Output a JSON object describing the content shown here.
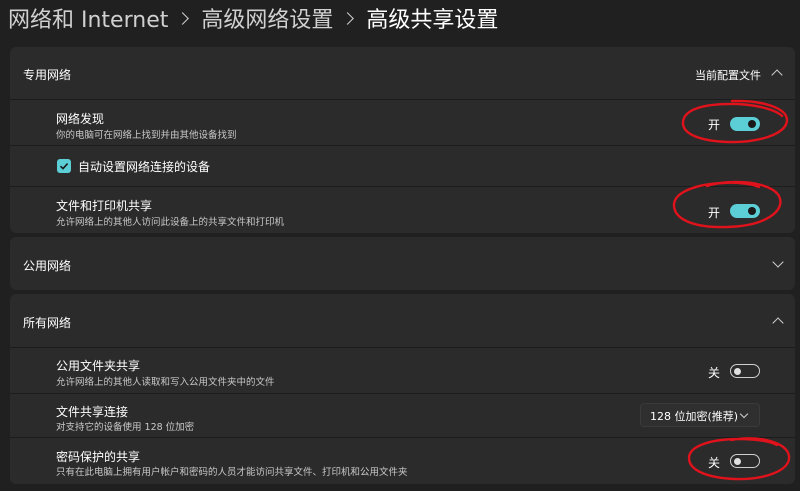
{
  "breadcrumb": {
    "items": [
      "网络和 Internet",
      "高级网络设置",
      "高级共享设置"
    ]
  },
  "private_network": {
    "title": "专用网络",
    "profile_label": "当前配置文件",
    "network_discovery": {
      "title": "网络发现",
      "description": "你的电脑可在网络上找到并由其他设备找到",
      "state_label": "开",
      "on": true
    },
    "auto_setup": {
      "label": "自动设置网络连接的设备",
      "checked": true
    },
    "file_printer_sharing": {
      "title": "文件和打印机共享",
      "description": "允许网络上的其他人访问此设备上的共享文件和打印机",
      "state_label": "开",
      "on": true
    }
  },
  "public_network": {
    "title": "公用网络"
  },
  "all_networks": {
    "title": "所有网络",
    "public_folder_sharing": {
      "title": "公用文件夹共享",
      "description": "允许网络上的其他人读取和写入公用文件夹中的文件",
      "state_label": "关",
      "on": false
    },
    "file_sharing_connections": {
      "title": "文件共享连接",
      "description": "对支持它的设备使用 128 位加密",
      "selected": "128 位加密(推荐)"
    },
    "password_protected_sharing": {
      "title": "密码保护的共享",
      "description": "只有在此电脑上拥有用户帐户和密码的人员才能访问共享文件、打印机和公用文件夹",
      "state_label": "关",
      "on": false
    }
  },
  "colors": {
    "accent": "#5ccfd6",
    "annotation": "#e0121b",
    "background": "#202020",
    "card": "#2b2b2b"
  }
}
